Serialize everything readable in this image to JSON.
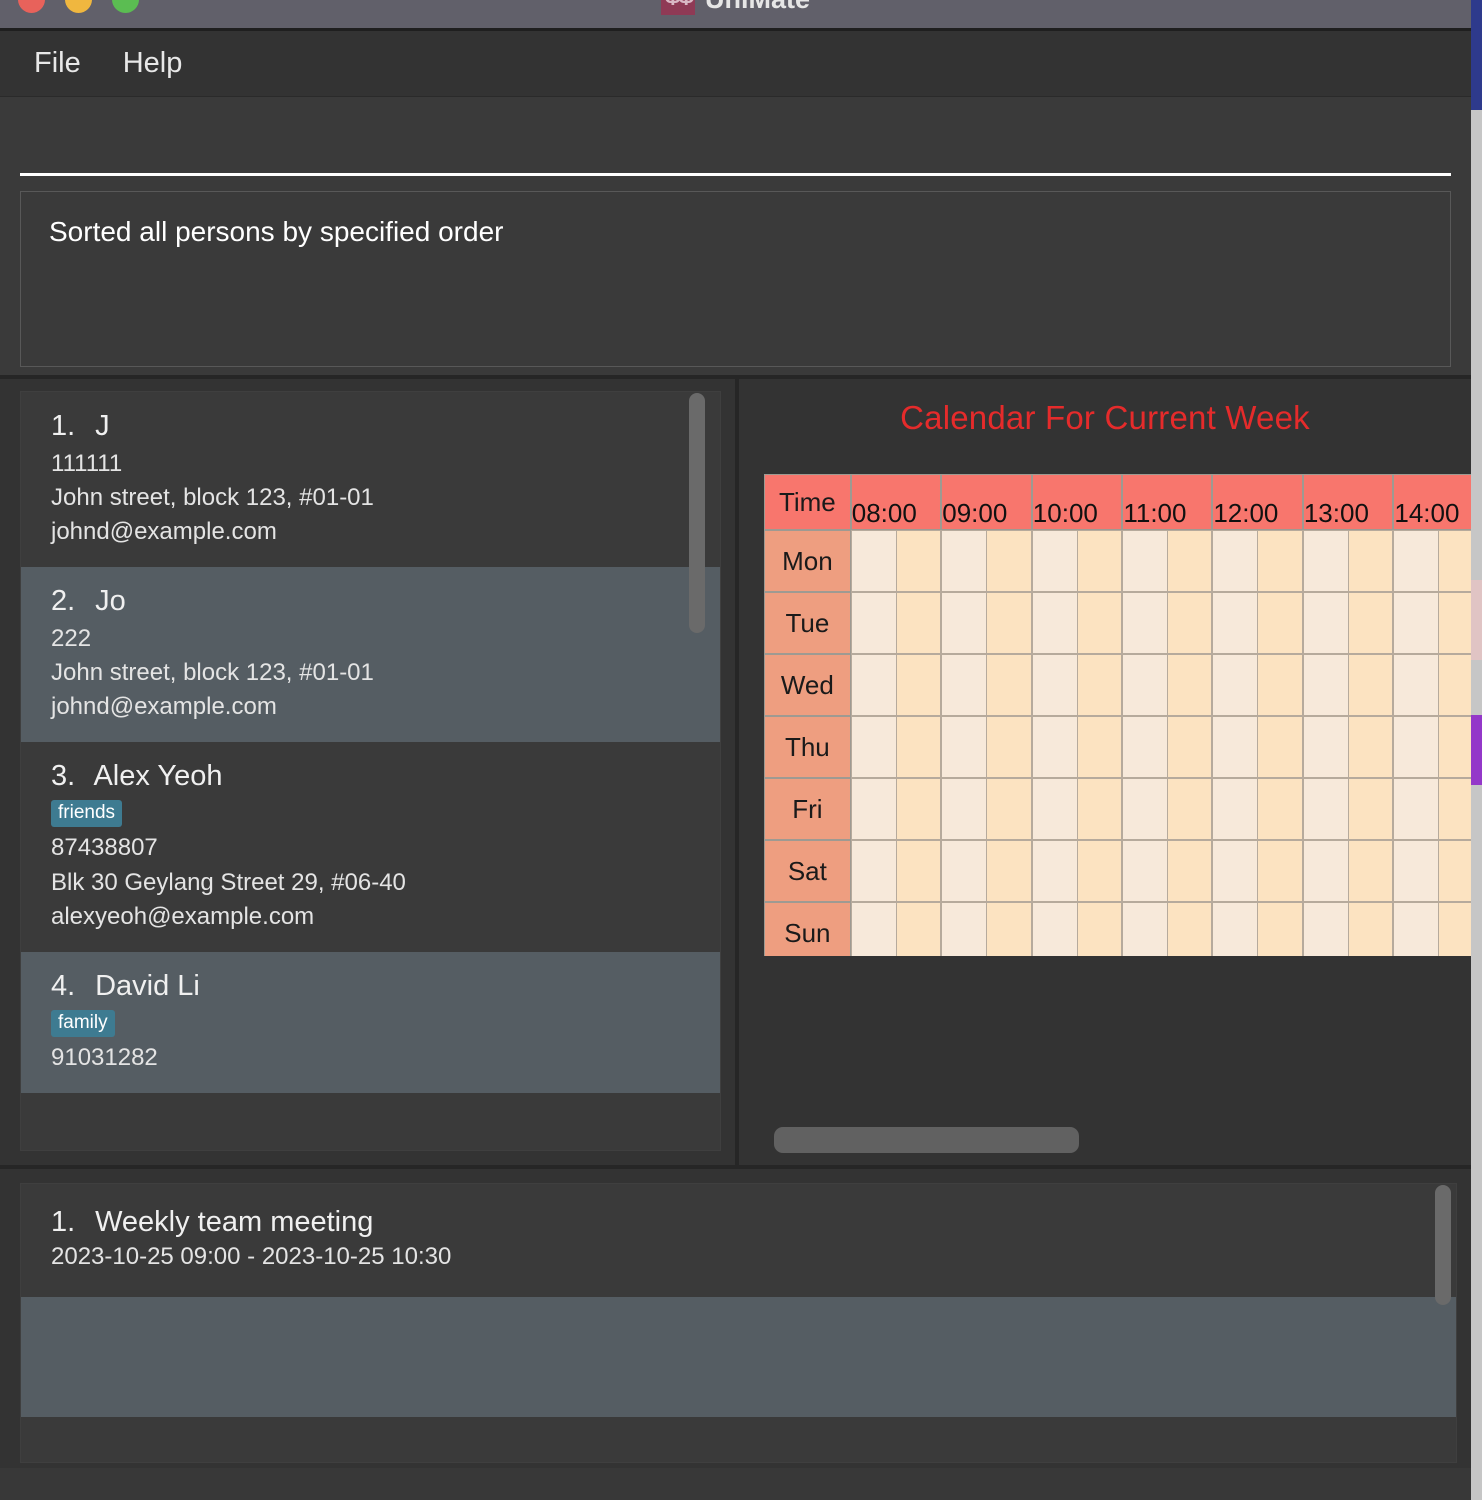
{
  "window": {
    "app_title": "UniMate",
    "app_icon": "unimate-logo-icon",
    "traffic_lights": [
      "close-button",
      "minimize-button",
      "maximize-button"
    ]
  },
  "menubar": {
    "items": [
      {
        "label": "File"
      },
      {
        "label": "Help"
      }
    ]
  },
  "command": {
    "value": "",
    "placeholder": ""
  },
  "result": {
    "text": "Sorted all persons by specified order"
  },
  "persons": {
    "items": [
      {
        "index": "1.",
        "name": "J",
        "tags": [],
        "phone": "111111",
        "address": "John street, block 123, #01-01",
        "email": "johnd@example.com"
      },
      {
        "index": "2.",
        "name": "Jo",
        "tags": [],
        "phone": "222",
        "address": "John street, block 123, #01-01",
        "email": "johnd@example.com"
      },
      {
        "index": "3.",
        "name": "Alex Yeoh",
        "tags": [
          "friends"
        ],
        "phone": "87438807",
        "address": "Blk 30 Geylang Street 29, #06-40",
        "email": "alexyeoh@example.com"
      },
      {
        "index": "4.",
        "name": "David Li",
        "tags": [
          "family"
        ],
        "phone": "91031282",
        "address": "",
        "email": ""
      }
    ]
  },
  "calendar": {
    "title": "Calendar For Current Week",
    "time_header_label": "Time",
    "hours": [
      "08:00",
      "09:00",
      "10:00",
      "11:00",
      "12:00",
      "13:00",
      "14:00"
    ],
    "days": [
      "Mon",
      "Tue",
      "Wed",
      "Thu",
      "Fri",
      "Sat",
      "Sun"
    ],
    "colors": {
      "title": "#e52b2b",
      "header": "#f8766d",
      "day_label": "#ee9e80",
      "slot_a": "#f7e9da",
      "slot_b": "#fce3c1"
    }
  },
  "events": {
    "items": [
      {
        "index": "1.",
        "title": "Weekly team meeting",
        "time": "2023-10-25 09:00 - 2023-10-25 10:30"
      },
      {
        "index": "",
        "title": "",
        "time": ""
      }
    ]
  }
}
